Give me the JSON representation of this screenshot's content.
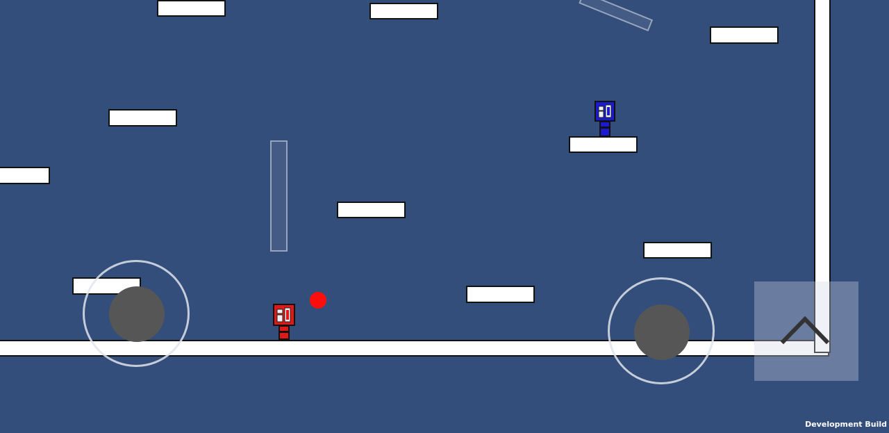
{
  "overlay": {
    "dev_build_label": "Development Build"
  },
  "players": [
    {
      "name": "red-player",
      "color": "#e01818"
    },
    {
      "name": "blue-player",
      "color": "#1a1ad0"
    }
  ],
  "controls": {
    "left_joystick": "move-joystick",
    "right_joystick": "aim-joystick",
    "jump_button_icon": "chevron-up-icon"
  },
  "colors": {
    "background": "#334e7b",
    "platform": "#ffffff",
    "ball": "#ff0d0d"
  }
}
